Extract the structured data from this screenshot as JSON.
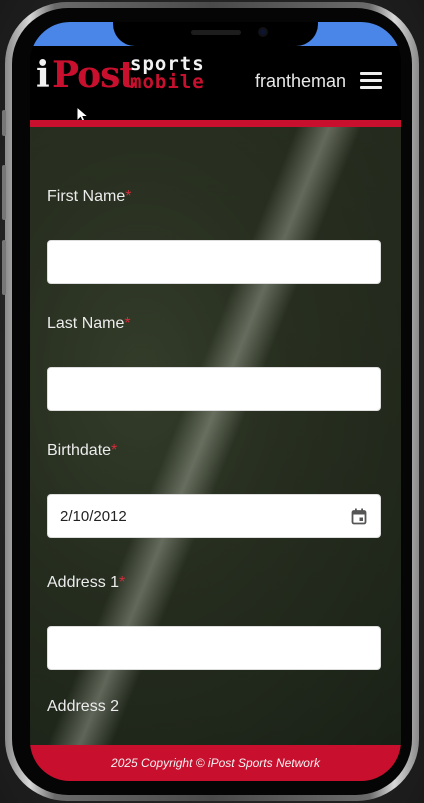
{
  "header": {
    "logo": {
      "i": "i",
      "post": "Post",
      "sports": "sports",
      "mobile": "mobile"
    },
    "username": "frantheman",
    "menu_icon": "hamburger-menu-icon"
  },
  "form": {
    "first_name": {
      "label": "First Name",
      "required": "*",
      "value": ""
    },
    "last_name": {
      "label": "Last Name",
      "required": "*",
      "value": ""
    },
    "birthdate": {
      "label": "Birthdate",
      "required": "*",
      "value": "2/10/2012",
      "icon": "calendar-icon"
    },
    "address1": {
      "label": "Address 1",
      "required": "*",
      "value": ""
    },
    "address2": {
      "label": "Address 2"
    }
  },
  "footer": {
    "copyright": "2025 Copyright © iPost Sports Network"
  },
  "colors": {
    "brand_red": "#c8102e",
    "status_strip": "#4a86e8"
  }
}
